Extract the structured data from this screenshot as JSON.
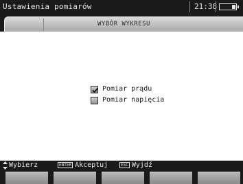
{
  "window": {
    "title": "Ustawienia pomiarów",
    "time": "21:38"
  },
  "tab": {
    "label": "WYBÓR WYKRESU"
  },
  "options": [
    {
      "label": "Pomiar prądu",
      "checked": true
    },
    {
      "label": "Pomiar napięcia",
      "checked": false
    }
  ],
  "statusbar": {
    "select_label": "Wybierz",
    "enter_key": "ENTER",
    "enter_label": "Akceptuj",
    "esc_key": "ESC",
    "esc_label": "Wyjdź"
  },
  "icons": {
    "updown": "up-down-arrows-icon",
    "battery": "battery-icon",
    "check": "checkmark-icon"
  },
  "colors": {
    "bar": "#1a1a1a",
    "bar_text": "#e6e6e6",
    "tab": "#c4c4c4",
    "background": "#ffffff"
  }
}
